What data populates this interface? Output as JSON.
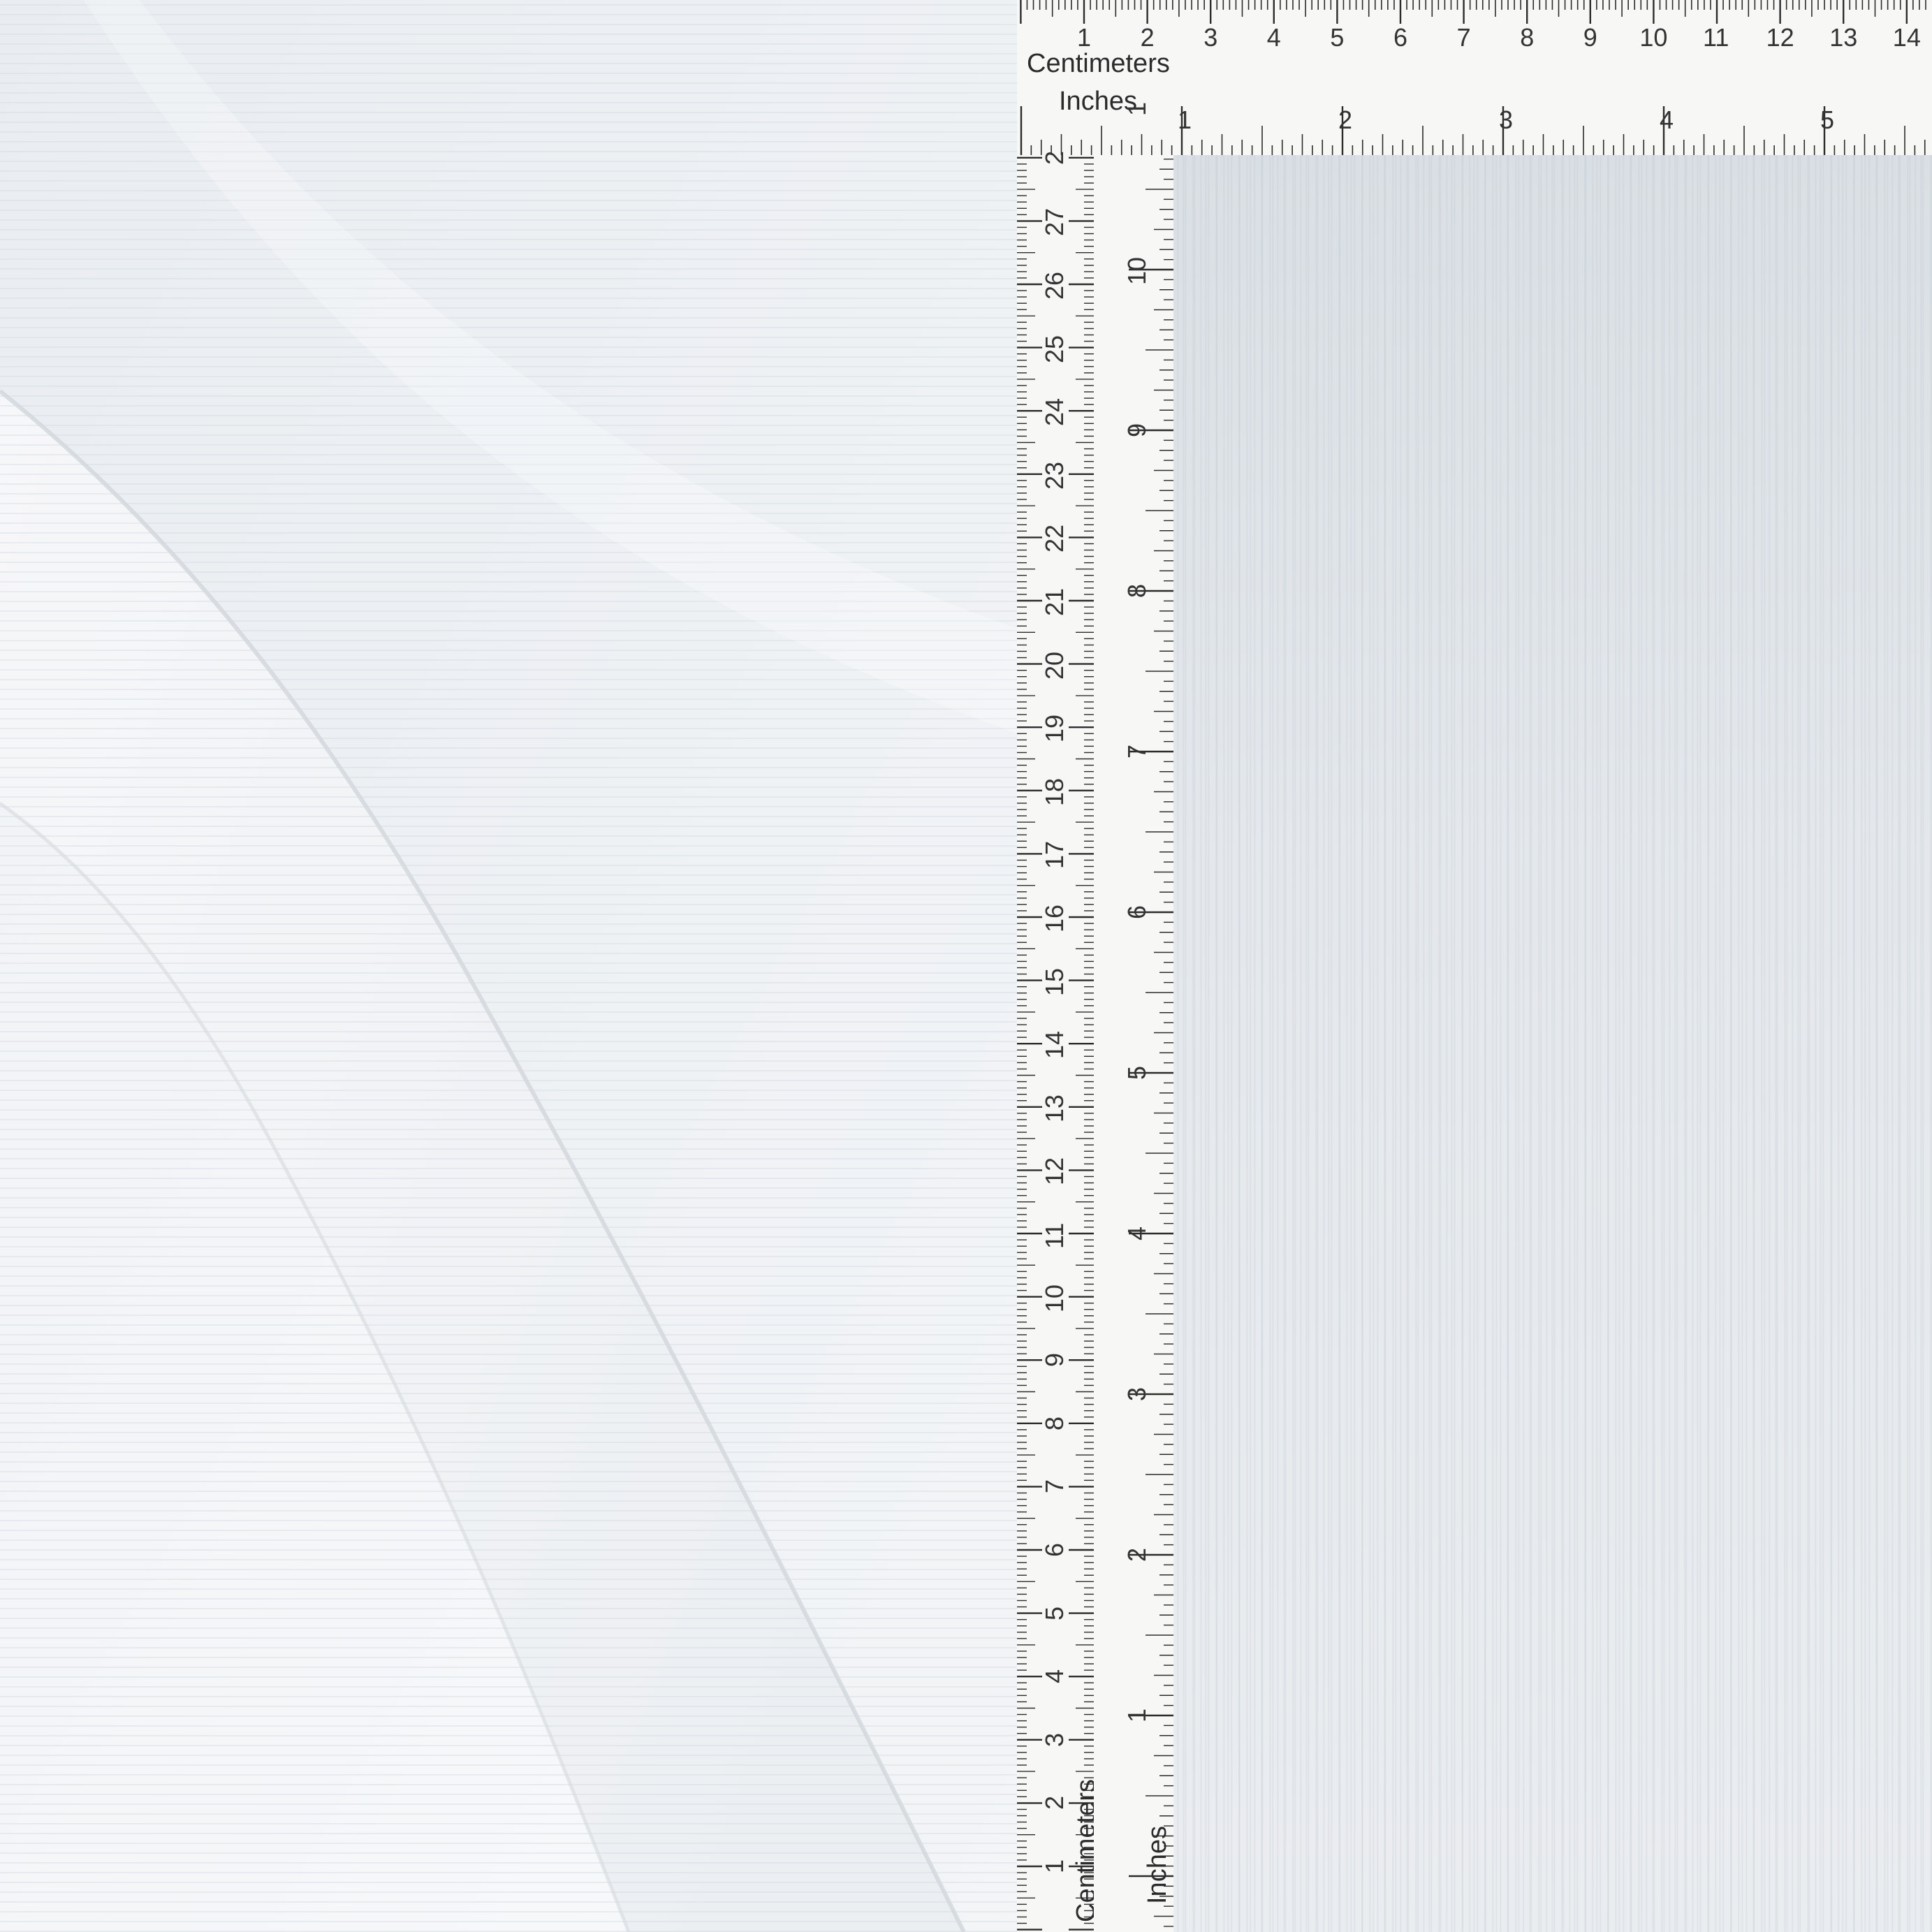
{
  "photo": {
    "subject": "white ribbed knit fabric",
    "colors": {
      "fabric_light": "#f4f6f8",
      "fabric_shadow": "#dfe3e7",
      "rib_line": "#cfd5db",
      "ruler_paper": "#f7f7f5",
      "ruler_ink": "#2b2b2b"
    }
  },
  "rulers": {
    "top_cm_label": "Centimeters",
    "top_in_label": "Inches",
    "left_cm_label": "Centimeters",
    "left_in_label": "Inches",
    "top_cm_numbers": [
      "1",
      "2",
      "3",
      "4",
      "5",
      "6",
      "7",
      "8",
      "9",
      "10",
      "11",
      "12",
      "13",
      "14"
    ],
    "top_in_numbers": [
      "1",
      "2",
      "3",
      "4",
      "5"
    ],
    "left_cm_numbers": [
      "1",
      "2",
      "3",
      "4",
      "5",
      "6",
      "7",
      "8",
      "9",
      "10",
      "11",
      "12",
      "13",
      "14",
      "15",
      "16",
      "17",
      "18",
      "19",
      "20",
      "21",
      "22",
      "23",
      "24",
      "25",
      "26",
      "27",
      "2"
    ],
    "left_in_numbers": [
      "1",
      "2",
      "3",
      "4",
      "5",
      "6",
      "7",
      "8",
      "9",
      "10",
      "1"
    ]
  }
}
